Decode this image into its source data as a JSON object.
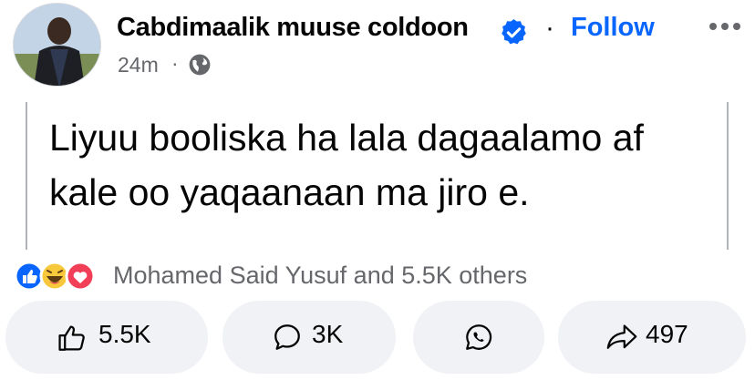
{
  "post": {
    "author": "Cabdimaalik muuse coldoon",
    "follow_label": "Follow",
    "separator": "·",
    "timestamp": "24m",
    "privacy_icon": "globe-icon",
    "text": "Liyuu booliska ha lala dagaalamo af kale oo yaqaanaan ma jiro e."
  },
  "reactions": {
    "icons": [
      "like-reaction-icon",
      "haha-reaction-icon",
      "love-reaction-icon"
    ],
    "summary": "Mohamed Said Yusuf and 5.5K others"
  },
  "actions": {
    "like_count": "5.5K",
    "comment_count": "3K",
    "share_count": "497"
  },
  "colors": {
    "accent": "#0866ff",
    "secondary_text": "#65676b",
    "button_bg": "#f0f2f5"
  }
}
